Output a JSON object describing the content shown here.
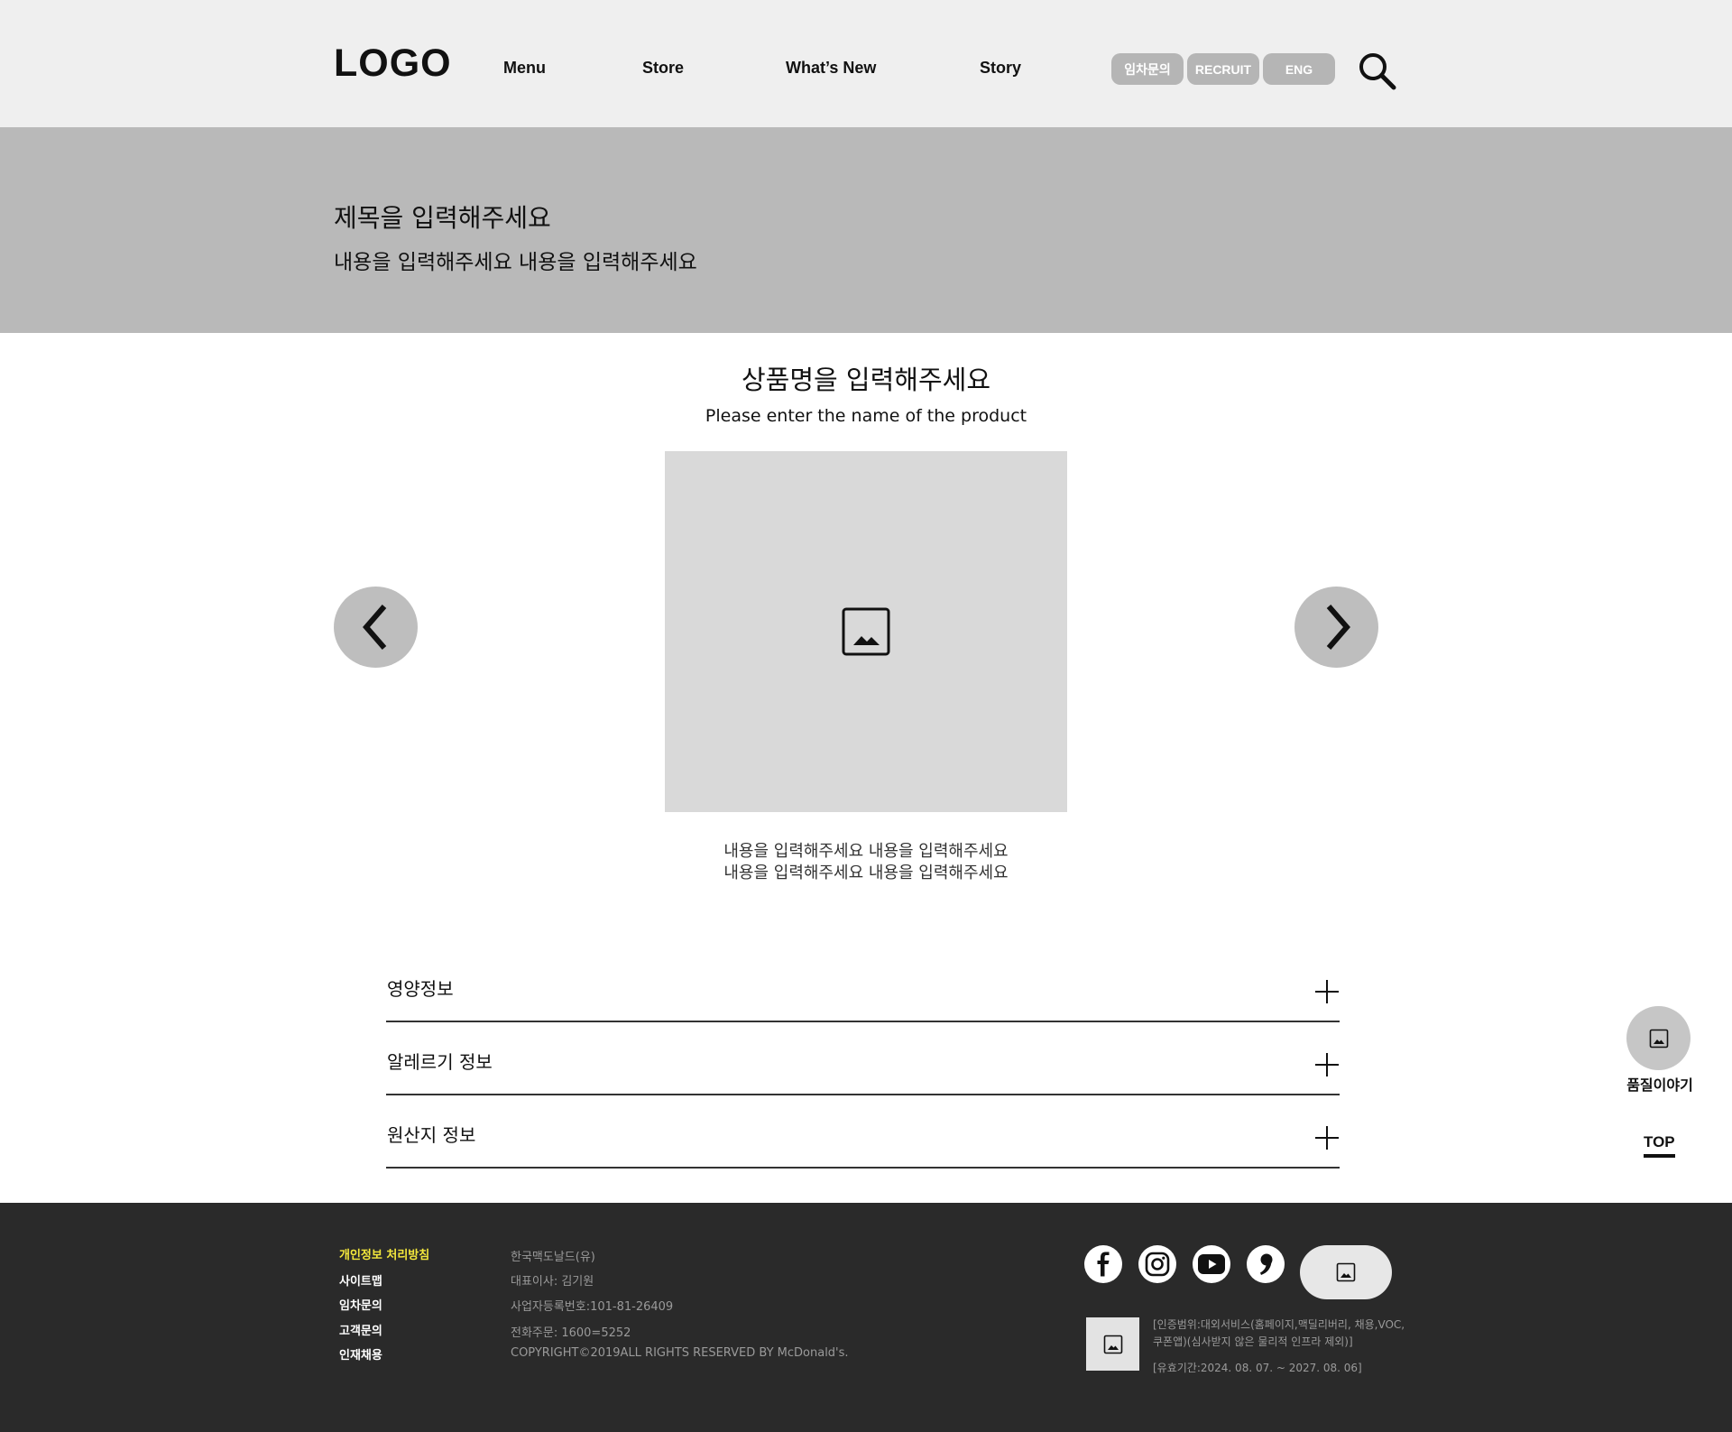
{
  "header": {
    "logo": "LOGO",
    "nav": [
      "Menu",
      "Store",
      "What’s New",
      "Story"
    ],
    "pills": [
      "임차문의",
      "RECRUIT",
      "ENG"
    ],
    "search_icon": "search-icon"
  },
  "hero": {
    "title": "제목을 입력해주세요",
    "subtitle": "내용을 입력해주세요 내용을 입력해주세요"
  },
  "product": {
    "name_ko": "상품명을 입력해주세요",
    "name_en": "Please enter the name of the product",
    "image_icon": "image-placeholder-icon",
    "description": [
      "내용을 입력해주세요 내용을 입력해주세요",
      "내용을 입력해주세요 내용을 입력해주세요"
    ],
    "prev_icon": "chevron-left-icon",
    "next_icon": "chevron-right-icon"
  },
  "accordion": [
    "영양정보",
    "알레르기 정보",
    "원산지 정보"
  ],
  "floating": {
    "label": "품질이야기",
    "top": "TOP"
  },
  "footer": {
    "links": [
      "개인정보 처리방침",
      "사이트맵",
      "임차문의",
      "고객문의",
      "인재채용"
    ],
    "info": [
      "한국맥도날드(유)",
      "대표이사: 김기원",
      "사업자등록번호:101-81-26409",
      "전화주문: 1600=5252",
      "COPYRIGHT©2019ALL RIGHTS RESERVED BY McDonald's."
    ],
    "social": [
      "facebook-icon",
      "instagram-icon",
      "youtube-icon",
      "blog-icon"
    ],
    "cert": [
      "[인증범위:대외서비스(홈페이지,맥딜리버리, 채용,VOC,",
      "쿠폰앱)(심사받지 않은 물리적 인프라 제외)]",
      "[유효기간:2024. 08. 07. ~ 2027. 08. 06]"
    ]
  },
  "colors": {
    "header_bg": "#efefef",
    "hero_bg": "#b9b9b9",
    "footer_bg": "#2a2a2a",
    "footer_highlight": "#f4e83c"
  }
}
